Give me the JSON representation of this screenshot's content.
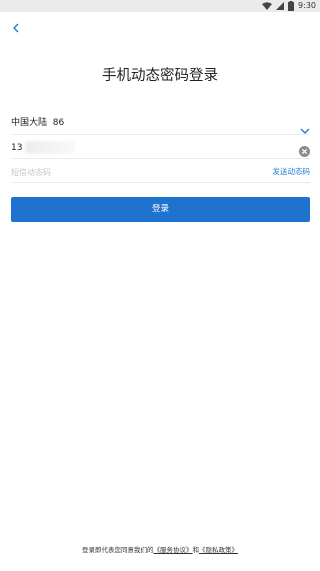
{
  "status_bar": {
    "time": "9:30"
  },
  "page": {
    "title": "手机动态密码登录"
  },
  "form": {
    "region": "中国大陆  86",
    "phone_value": "13",
    "code_placeholder": "短信动态码",
    "send_code_label": "发送动态码",
    "login_label": "登录"
  },
  "footer": {
    "prefix": "登录即代表您同意我们的",
    "service_link": "《服务协议》",
    "and": "和",
    "privacy_link": "《隐私政策》"
  },
  "colors": {
    "accent": "#1e73cf",
    "link": "#1c7ed6"
  }
}
